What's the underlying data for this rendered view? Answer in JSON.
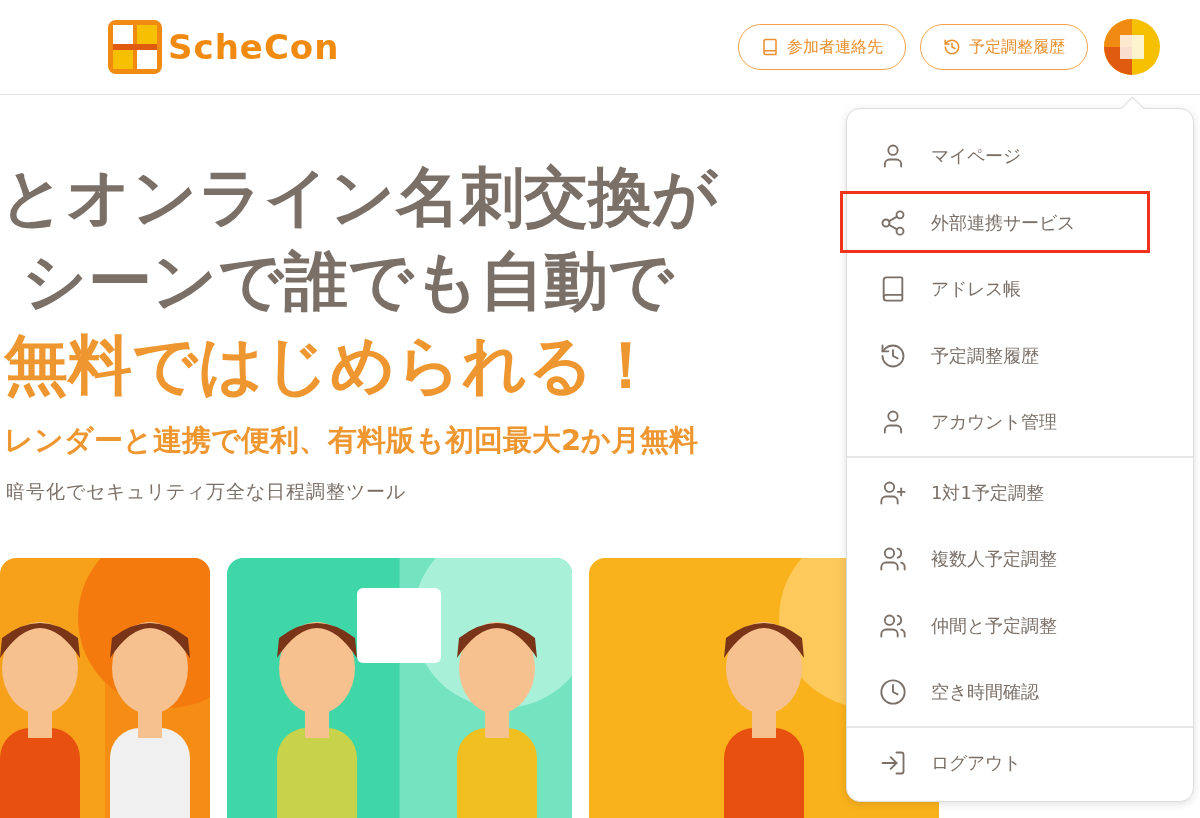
{
  "header": {
    "brand": "ScheCon",
    "buttons": [
      {
        "label": "参加者連絡先"
      },
      {
        "label": "予定調整履歴"
      }
    ]
  },
  "hero": {
    "lines": [
      {
        "text": "とオンライン名刺交換が",
        "kind": "title"
      },
      {
        "text": "シーンで誰でも自動で",
        "kind": "title"
      },
      {
        "text": "無料ではじめられる！",
        "kind": "accent"
      },
      {
        "text": "レンダーと連携で便利、有料版も初回最大2か月無料",
        "kind": "sub"
      },
      {
        "text": "暗号化でセキュリティ万全な日程調整ツール",
        "kind": "note"
      }
    ]
  },
  "menu": {
    "groups": [
      [
        {
          "label": "マイページ",
          "selected": false
        },
        {
          "label": "外部連携サービス",
          "selected": true
        },
        {
          "label": "アドレス帳",
          "selected": false
        },
        {
          "label": "予定調整履歴",
          "selected": false
        },
        {
          "label": "アカウント管理",
          "selected": false
        }
      ],
      [
        {
          "label": "1対1予定調整",
          "selected": false
        },
        {
          "label": "複数人予定調整",
          "selected": false
        },
        {
          "label": "仲間と予定調整",
          "selected": false
        },
        {
          "label": "空き時間確認",
          "selected": false
        }
      ],
      [
        {
          "label": "ログアウト",
          "selected": false
        }
      ]
    ]
  }
}
